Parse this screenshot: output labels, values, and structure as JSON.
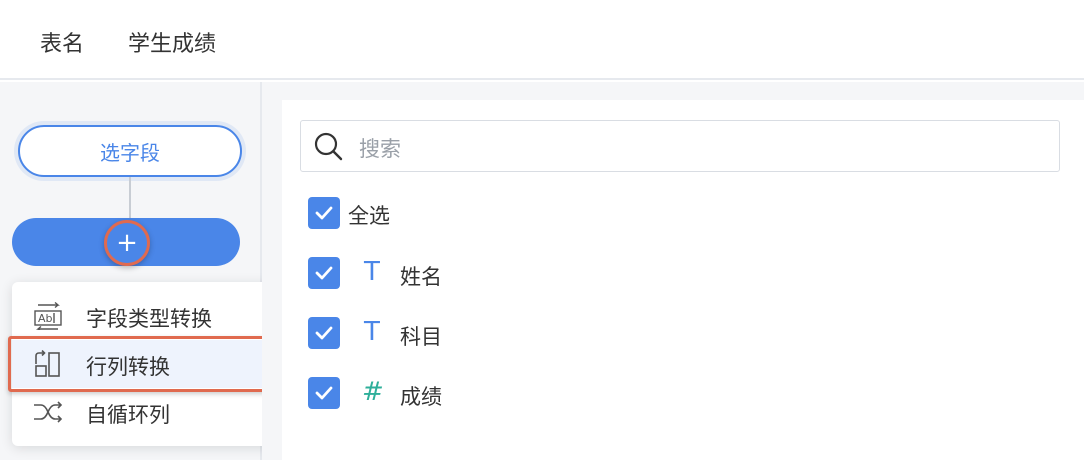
{
  "header": {
    "label": "表名",
    "value": "学生成绩"
  },
  "flow": {
    "select_node": "选字段",
    "add_button": "+"
  },
  "menu": {
    "items": [
      {
        "label": "字段类型转换",
        "icon": "field-type-convert-icon"
      },
      {
        "label": "行列转换",
        "icon": "row-column-transpose-icon"
      },
      {
        "label": "自循环列",
        "icon": "shuffle-icon"
      }
    ],
    "highlighted_index": 1
  },
  "search": {
    "placeholder": "搜索",
    "icon": "search-icon"
  },
  "fields": {
    "select_all": {
      "label": "全选",
      "checked": true
    },
    "items": [
      {
        "label": "姓名",
        "type_icon": "T",
        "type": "text",
        "checked": true
      },
      {
        "label": "科目",
        "type_icon": "T",
        "type": "text",
        "checked": true
      },
      {
        "label": "成绩",
        "type_icon": "#",
        "type": "number",
        "checked": true
      }
    ]
  },
  "colors": {
    "accent": "#4a86e8",
    "highlight": "#e06a4f",
    "number_type": "#2eaf9a"
  }
}
